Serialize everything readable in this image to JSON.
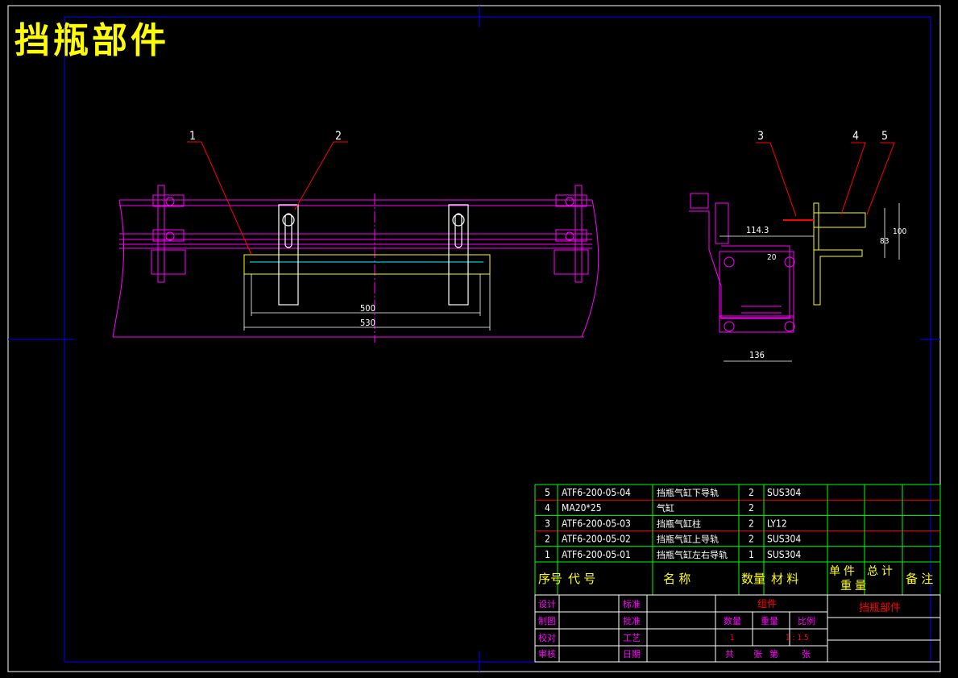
{
  "title": "挡瓶部件",
  "callouts": [
    "1",
    "2",
    "3",
    "4",
    "5"
  ],
  "dimensions": {
    "front_inner": "500",
    "front_outer": "530",
    "side_top": "114.3",
    "side_width": "136",
    "side_small": "20",
    "side_right_a": "83",
    "side_right_b": "100"
  },
  "parts_list": {
    "rows": [
      {
        "no": "5",
        "code": "ATF6-200-05-04",
        "name": "挡瓶气缸下导轨",
        "qty": "2",
        "material": "SUS304"
      },
      {
        "no": "4",
        "code": "MA20*25",
        "name": "气缸",
        "qty": "2",
        "material": ""
      },
      {
        "no": "3",
        "code": "ATF6-200-05-03",
        "name": "挡瓶气缸柱",
        "qty": "2",
        "material": "LY12"
      },
      {
        "no": "2",
        "code": "ATF6-200-05-02",
        "name": "挡瓶气缸上导轨",
        "qty": "2",
        "material": "SUS304"
      },
      {
        "no": "1",
        "code": "ATF6-200-05-01",
        "name": "挡瓶气缸左右导轨",
        "qty": "1",
        "material": "SUS304"
      }
    ],
    "header": {
      "no": "序号",
      "code": "代 号",
      "name": "名 称",
      "qty": "数量",
      "material": "材 料",
      "unit_weight": "单 件",
      "total_weight": "总 计",
      "weight": "重 量",
      "remark": "备 注"
    }
  },
  "title_block": {
    "design": "设计",
    "drawing": "制图",
    "check": "校对",
    "review": "审核",
    "standard": "标准",
    "approve": "批准",
    "process": "工艺",
    "date": "日期",
    "assembly": "组件",
    "quantity": "数量",
    "mass": "重量",
    "scale": "比例",
    "quantity_value": "1",
    "scale_value": "1 : 1.5",
    "total": "共",
    "sheets": "张",
    "sheet_no": "第",
    "sheet": "张",
    "part_name": "挡瓶部件"
  },
  "colors": {
    "border": "#ffffff",
    "frame": "#0000ff",
    "magenta": "#ff00ff",
    "yellow": "#ffff00",
    "green": "#00ff00",
    "cyan": "#00ffff",
    "red": "#ff0000",
    "white": "#ffffff"
  }
}
